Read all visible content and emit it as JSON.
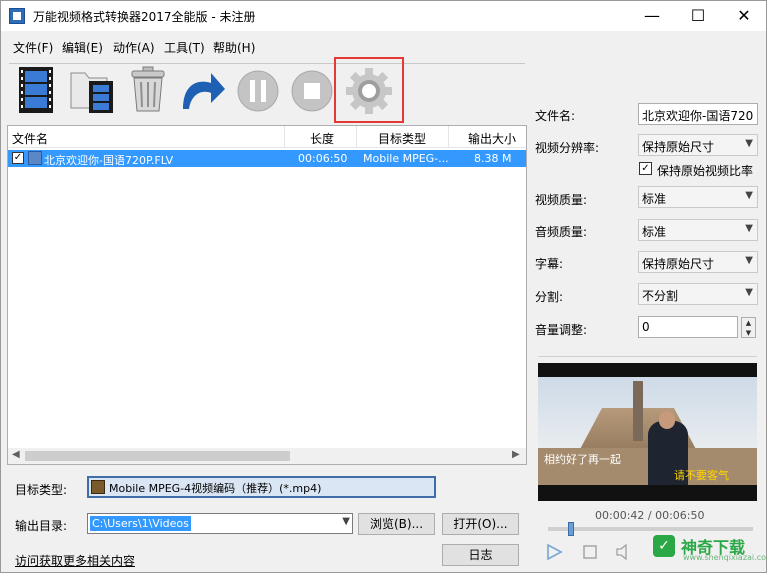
{
  "window": {
    "title": "万能视频格式转换器2017全能版 - 未注册",
    "minimize": "—",
    "maximize": "☐",
    "close": "✕"
  },
  "menu": [
    "文件(F)",
    "编辑(E)",
    "动作(A)",
    "工具(T)",
    "帮助(H)"
  ],
  "toolbar": {
    "icons": [
      "add-video-icon",
      "add-folder-icon",
      "delete-icon",
      "redo-icon",
      "pause-icon",
      "stop-icon",
      "settings-icon"
    ],
    "highlight_color": "#e53935"
  },
  "file_list": {
    "columns": [
      "文件名",
      "长度",
      "目标类型",
      "输出大小"
    ],
    "rows": [
      {
        "checked": "✓",
        "name": "北京欢迎你-国语720P.FLV",
        "length": "00:06:50",
        "target": "Mobile MPEG-...",
        "size": "8.38 M"
      }
    ],
    "selection_color": "#3399ff"
  },
  "bottom": {
    "target_label": "目标类型:",
    "target_value": "Mobile MPEG-4视频编码（推荐）(*.mp4)",
    "output_label": "输出目录:",
    "output_value": "C:\\Users\\1\\Videos",
    "browse": "浏览(B)...",
    "open": "打开(O)...",
    "more_link": "访问获取更多相关内容",
    "log": "日志"
  },
  "settings": {
    "filename_label": "文件名:",
    "filename_value": "北京欢迎你-国语720P",
    "resolution_label": "视频分辨率:",
    "resolution_value": "保持原始尺寸",
    "keep_ratio_label": "保持原始视频比率",
    "keep_ratio_checked": "✓",
    "video_quality_label": "视频质量:",
    "video_quality_value": "标准",
    "audio_quality_label": "音频质量:",
    "audio_quality_value": "标准",
    "subtitle_label": "字幕:",
    "subtitle_value": "保持原始尺寸",
    "split_label": "分割:",
    "split_value": "不分割",
    "volume_label": "音量调整:",
    "volume_value": "0"
  },
  "preview": {
    "subtitle_left": "相约好了再一起",
    "subtitle_right": "请不要客气",
    "timecode": "00:00:42 / 00:06:50",
    "progress_fraction": 0.1
  },
  "watermark": {
    "text": "神奇下载",
    "sub": "www.shenqixiazai.com"
  }
}
